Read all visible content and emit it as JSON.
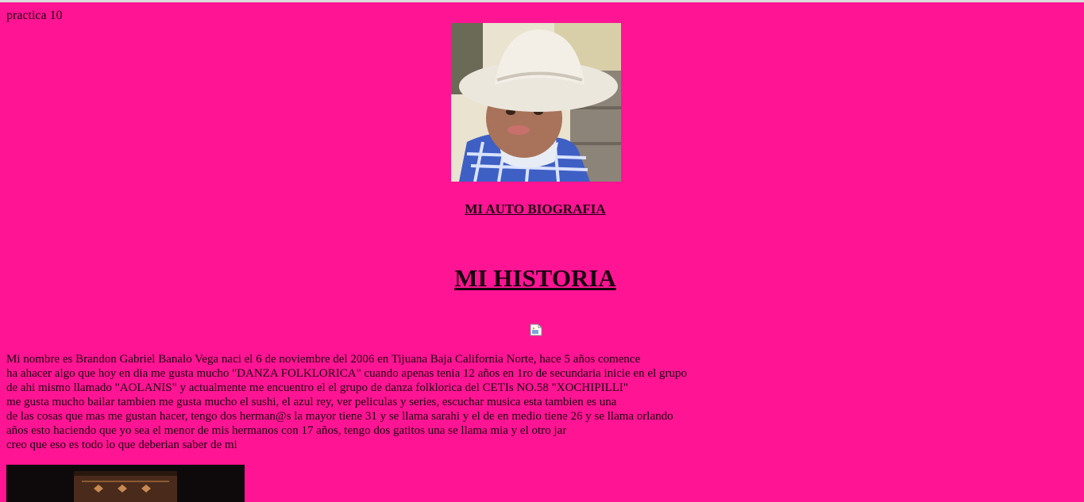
{
  "page": {
    "label": "practica 10",
    "background": "#ff1493"
  },
  "header": {
    "subtitle": "MI AUTO BIOGRAFIA",
    "title": "MI HISTORIA"
  },
  "story": {
    "lines": [
      "Mi nombre es Brandon Gabriel Banalo Vega naci el 6 de noviembre del 2006 en Tijuana Baja California Norte, hace 5 años comence",
      "ha ahacer algo que hoy en dia me gusta mucho \"DANZA FOLKLORICA\" cuando apenas tenia 12 años en 1ro de secundaria inicie en el grupo",
      "de ahi mismo llamado \"AOLANIS\" y actualmente me encuentro el el grupo de danza folklorica del CETIs NO.58 \"XOCHIPILLI\"",
      "me gusta mucho bailar tambien me gusta mucho el sushi, el azul rey, ver peliculas y series, escuchar musica esta tambien es una",
      "de las cosas que mas me gustan hacer, tengo dos herman@s la mayor tiene 31 y se llama sarahi y el de en medio tiene 26 y se llama orlando",
      "años esto haciendo que yo sea el menor de mis hermanos con 17 años, tengo dos gatitos una se llama mia y el otro jar",
      "creo que eso es todo lo que deberian saber de mi"
    ]
  },
  "icons": {
    "broken_image": "broken-image-icon"
  }
}
